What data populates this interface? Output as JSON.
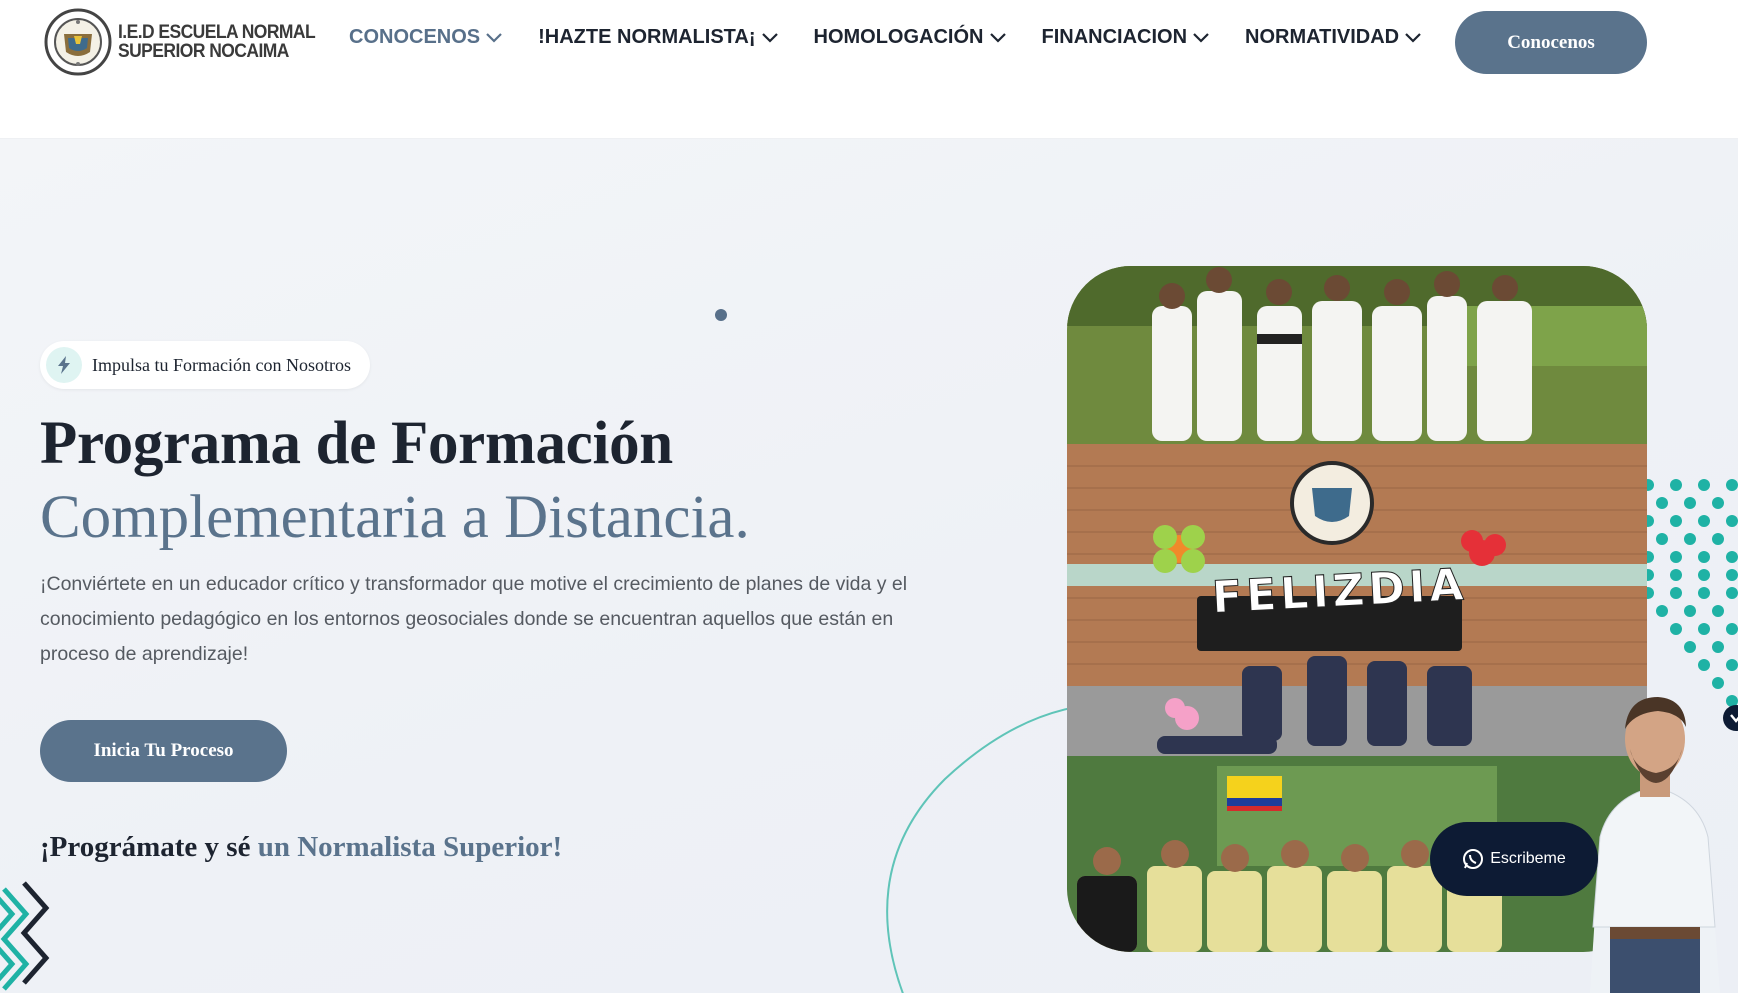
{
  "header": {
    "logo_line1": "I.E.D ESCUELA NORMAL",
    "logo_line2": "SUPERIOR NOCAIMA",
    "nav": [
      {
        "label": "CONOCENOS",
        "active": true
      },
      {
        "label": "!HAZTE NORMALISTA¡",
        "active": false
      },
      {
        "label": "HOMOLOGACIÓN",
        "active": false
      },
      {
        "label": "FINANCIACION",
        "active": false
      },
      {
        "label": "NORMATIVIDAD",
        "active": false
      }
    ],
    "cta_label": "Conocenos"
  },
  "hero": {
    "badge_text": "Impulsa tu Formación con Nosotros",
    "title_line1": "Programa de Formación",
    "title_line2": "Complementaria a Distancia.",
    "description": "¡Conviértete en un educador crítico y transformador que motive el crecimiento de planes de vida y el conocimiento pedagógico en los entornos geosociales donde se encuentran aquellos que están en proceso de aprendizaje!",
    "cta_label": "Inicia Tu Proceso",
    "tagline_part1": "¡Prográmate y sé ",
    "tagline_part2": "un Normalista Superior!"
  },
  "photo": {
    "sign_text": "FELIZDIA"
  },
  "chat": {
    "label": "Escribeme"
  },
  "colors": {
    "accent": "#5a738c",
    "dark": "#1d2430",
    "teal": "#1fb2a5"
  },
  "icons": [
    "chevron-down-icon",
    "lightning-icon",
    "whatsapp-icon",
    "close-icon"
  ]
}
